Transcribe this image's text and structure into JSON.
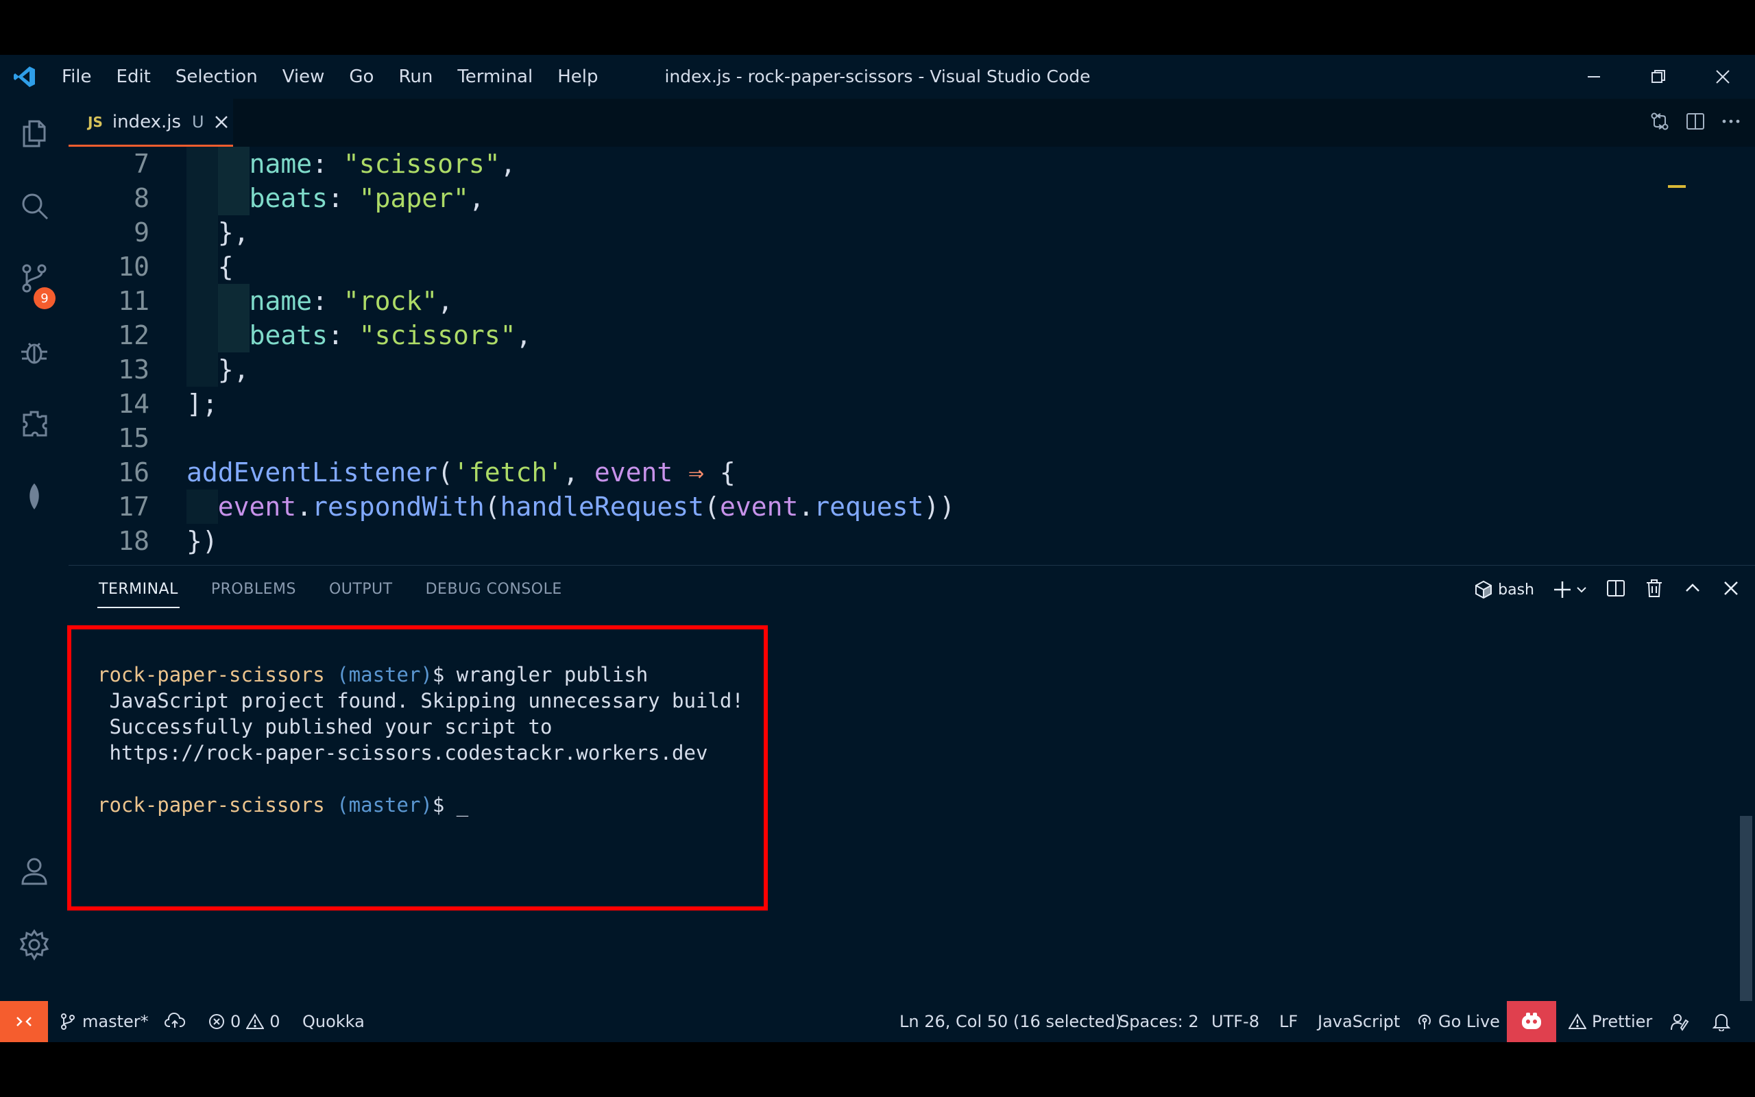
{
  "window": {
    "title": "index.js - rock-paper-scissors - Visual Studio Code"
  },
  "menu": [
    "File",
    "Edit",
    "Selection",
    "View",
    "Go",
    "Run",
    "Terminal",
    "Help"
  ],
  "activity_bar": {
    "icons": [
      "explorer-icon",
      "search-icon",
      "source-control-icon",
      "debug-icon",
      "extensions-icon",
      "leaf-icon",
      "account-icon",
      "gear-icon"
    ],
    "scm_badge": "9"
  },
  "tab": {
    "icon_text": "JS",
    "filename": "index.js",
    "status": "U"
  },
  "editor": {
    "lines": [
      {
        "n": "7",
        "tokens": [
          [
            "k",
            "name"
          ],
          [
            "p",
            ": "
          ],
          [
            "s",
            "\"scissors\""
          ],
          [
            "p",
            ","
          ]
        ],
        "indent": 2
      },
      {
        "n": "8",
        "tokens": [
          [
            "k",
            "beats"
          ],
          [
            "p",
            ": "
          ],
          [
            "s",
            "\"paper\""
          ],
          [
            "p",
            ","
          ]
        ],
        "indent": 2
      },
      {
        "n": "9",
        "tokens": [
          [
            "p",
            "},"
          ]
        ],
        "indent": 1
      },
      {
        "n": "10",
        "tokens": [
          [
            "p",
            "{"
          ]
        ],
        "indent": 1
      },
      {
        "n": "11",
        "tokens": [
          [
            "k",
            "name"
          ],
          [
            "p",
            ": "
          ],
          [
            "s",
            "\"rock\""
          ],
          [
            "p",
            ","
          ]
        ],
        "indent": 2
      },
      {
        "n": "12",
        "tokens": [
          [
            "k",
            "beats"
          ],
          [
            "p",
            ": "
          ],
          [
            "s",
            "\"scissors\""
          ],
          [
            "p",
            ","
          ]
        ],
        "indent": 2
      },
      {
        "n": "13",
        "tokens": [
          [
            "p",
            "},"
          ]
        ],
        "indent": 1
      },
      {
        "n": "14",
        "tokens": [
          [
            "p",
            "];"
          ]
        ],
        "indent": 0
      },
      {
        "n": "15",
        "tokens": [],
        "indent": 0
      },
      {
        "n": "16",
        "tokens": [
          [
            "f",
            "addEventListener"
          ],
          [
            "p",
            "("
          ],
          [
            "s",
            "'fetch'"
          ],
          [
            "p",
            ", "
          ],
          [
            "v",
            "event"
          ],
          [
            "p",
            " "
          ],
          [
            "o",
            "⇒"
          ],
          [
            "p",
            " {"
          ]
        ],
        "indent": 0
      },
      {
        "n": "17",
        "tokens": [
          [
            "v",
            "event"
          ],
          [
            "p",
            "."
          ],
          [
            "f",
            "respondWith"
          ],
          [
            "p",
            "("
          ],
          [
            "f",
            "handleRequest"
          ],
          [
            "p",
            "("
          ],
          [
            "v",
            "event"
          ],
          [
            "p",
            "."
          ],
          [
            "f",
            "request"
          ],
          [
            "p",
            "))"
          ]
        ],
        "indent": 1
      },
      {
        "n": "18",
        "tokens": [
          [
            "p",
            "})"
          ]
        ],
        "indent": 0
      }
    ]
  },
  "panel": {
    "tabs": [
      "TERMINAL",
      "PROBLEMS",
      "OUTPUT",
      "DEBUG CONSOLE"
    ],
    "shell": "bash",
    "terminal": {
      "prompt_dir": "rock-paper-scissors",
      "prompt_branch": " (master)",
      "prompt_symbol": "$ ",
      "command": "wrangler publish",
      "output": [
        " JavaScript project found. Skipping unnecessary build!",
        " Successfully published your script to",
        " https://rock-paper-scissors.codestackr.workers.dev"
      ],
      "cursor": "_"
    }
  },
  "status_bar": {
    "branch": "master*",
    "errors": "0",
    "warnings": "0",
    "quokka": "Quokka",
    "position": "Ln 26, Col 50 (16 selected)",
    "spaces": "Spaces: 2",
    "encoding": "UTF-8",
    "eol": "LF",
    "language": "JavaScript",
    "go_live": "Go Live",
    "prettier": "Prettier"
  },
  "colors": {
    "background": "#011627",
    "accent": "#f55d2e",
    "highlight_box": "#ff0000"
  }
}
